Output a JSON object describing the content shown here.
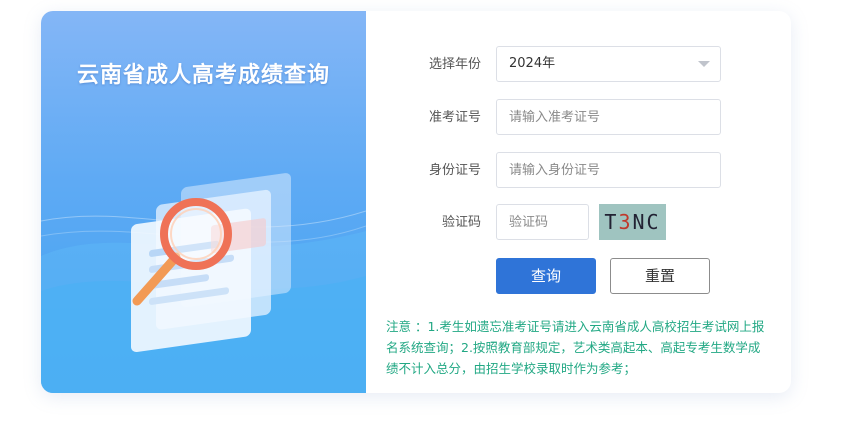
{
  "page": {
    "title": "云南省成人高考成绩查询"
  },
  "form": {
    "year": {
      "label": "选择年份",
      "value": "2024年"
    },
    "exam_number": {
      "label": "准考证号",
      "placeholder": "请输入准考证号"
    },
    "id_number": {
      "label": "身份证号",
      "placeholder": "请输入身份证号"
    },
    "captcha": {
      "label": "验证码",
      "placeholder": "验证码",
      "image_text_1": "T",
      "image_text_2": "3",
      "image_text_3": "NC"
    },
    "query_button": "查询",
    "reset_button": "重置"
  },
  "notice": "注意 ：1.考生如遗忘准考证号请进入云南省成人高校招生考试网上报名系统查询；2.按照教育部规定，艺术类高起本、高起专考生数学成绩不计入总分，由招生学校录取时作为参考；",
  "colors": {
    "primary": "#2f74d8",
    "notice": "#22a884",
    "panel_top": "#84b6f6",
    "panel_bottom": "#3fa2f0"
  },
  "icons": {
    "year_select": "chevron-down-icon",
    "illustration": "magnifier-documents-illustration"
  }
}
